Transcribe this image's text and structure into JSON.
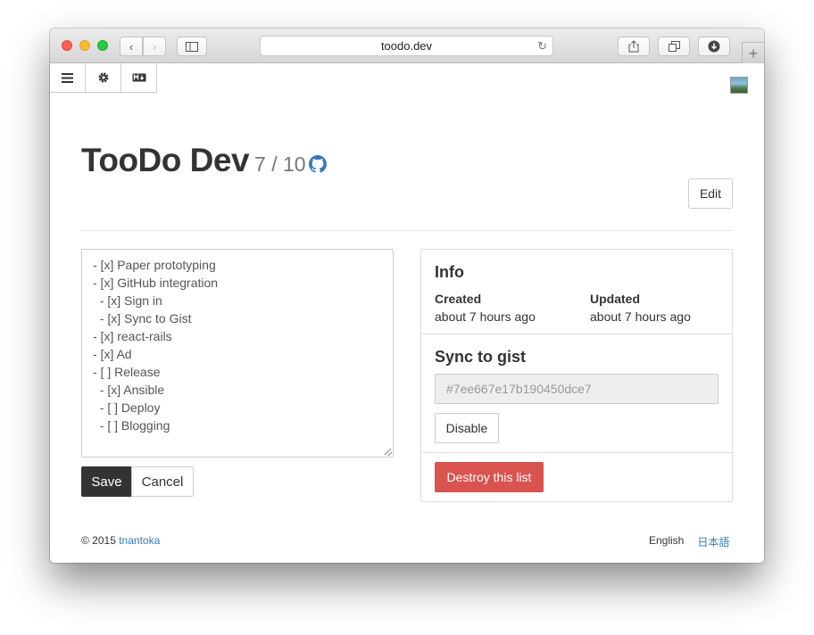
{
  "browser": {
    "url": "toodo.dev",
    "back_glyph": "‹",
    "forward_glyph": "›",
    "new_tab_glyph": "+",
    "reload_glyph": "↻"
  },
  "appbar": {
    "icons": [
      "menu-icon",
      "gear-icon",
      "markdown-icon"
    ]
  },
  "header": {
    "title": "TooDo Dev",
    "progress": "7 / 10",
    "edit_label": "Edit"
  },
  "editor": {
    "lines": [
      "- [x] Paper prototyping",
      "- [x] GitHub integration",
      "  - [x] Sign in",
      "  - [x] Sync to Gist",
      "- [x] react-rails",
      "- [x] Ad",
      "- [ ] Release",
      "  - [x] Ansible",
      "  - [ ] Deploy",
      "  - [ ] Blogging"
    ],
    "save_label": "Save",
    "cancel_label": "Cancel"
  },
  "info": {
    "heading": "Info",
    "created_label": "Created",
    "created_value": "about 7 hours ago",
    "updated_label": "Updated",
    "updated_value": "about 7 hours ago"
  },
  "gist": {
    "heading": "Sync to gist",
    "placeholder": "#7ee667e17b190450dce7",
    "disable_label": "Disable"
  },
  "danger": {
    "destroy_label": "Destroy this list"
  },
  "footer": {
    "copyright": "© 2015",
    "author": "tnantoka",
    "lang_en": "English",
    "lang_ja": "日本語"
  },
  "colors": {
    "primary_dark": "#333333",
    "danger": "#d9534f",
    "link": "#337ab7"
  }
}
